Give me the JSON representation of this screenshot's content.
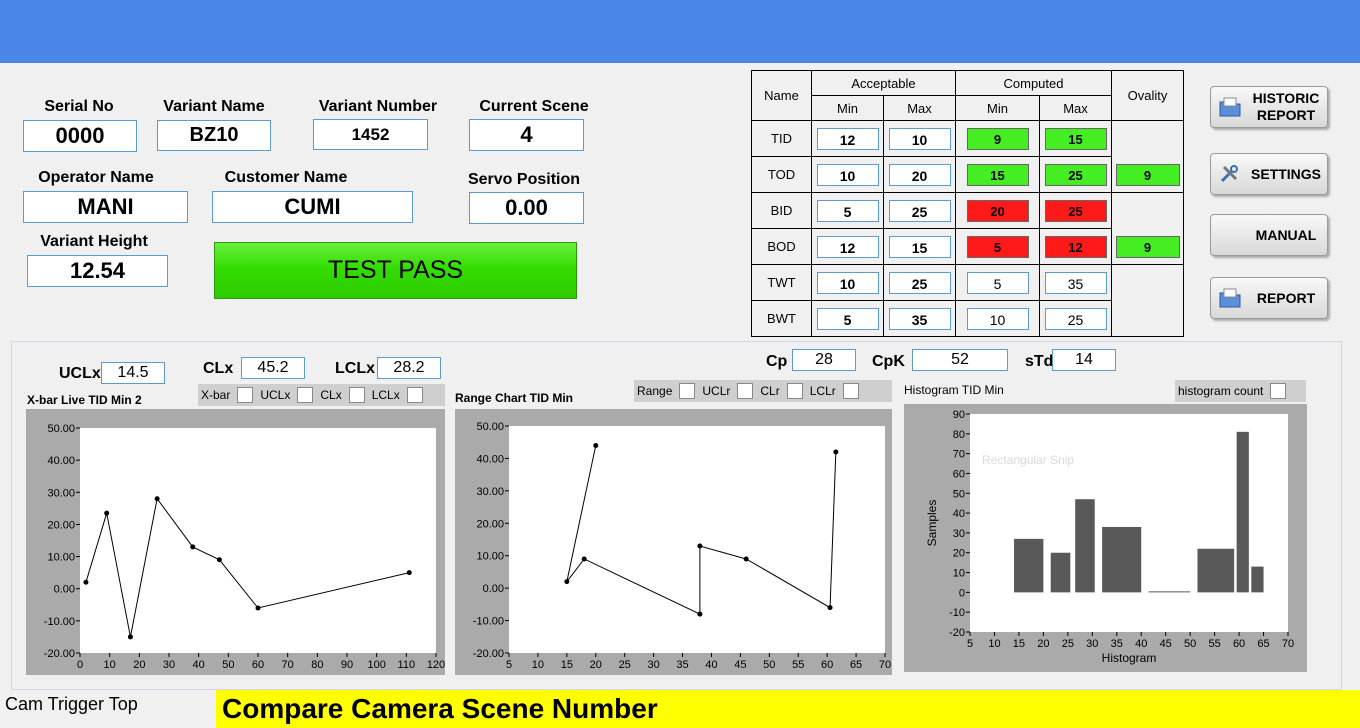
{
  "header": {
    "color": "#4a86e8"
  },
  "fields": {
    "serial_no": {
      "label": "Serial No",
      "value": "0000"
    },
    "variant_name": {
      "label": "Variant Name",
      "value": "BZ10"
    },
    "variant_number": {
      "label": "Variant Number",
      "value": "1452"
    },
    "current_scene": {
      "label": "Current Scene",
      "value": "4"
    },
    "operator_name": {
      "label": "Operator Name",
      "value": "MANI"
    },
    "customer_name": {
      "label": "Customer Name",
      "value": "CUMI"
    },
    "servo_position": {
      "label": "Servo Position",
      "value": "0.00"
    },
    "variant_height": {
      "label": "Variant Height",
      "value": "12.54"
    }
  },
  "test_status": {
    "text": "TEST PASS",
    "color": "#33dd00"
  },
  "spec_table": {
    "name_header": "Name",
    "acceptable_header": "Acceptable",
    "computed_header": "Computed",
    "min_header": "Min",
    "max_header": "Max",
    "ovality_header": "Ovality",
    "rows": [
      {
        "name": "TID",
        "acc_min": "12",
        "acc_max": "10",
        "comp_min": "9",
        "comp_max": "15",
        "min_status": "g",
        "max_status": "g"
      },
      {
        "name": "TOD",
        "acc_min": "10",
        "acc_max": "20",
        "comp_min": "15",
        "comp_max": "25",
        "min_status": "g",
        "max_status": "g"
      },
      {
        "name": "BID",
        "acc_min": "5",
        "acc_max": "25",
        "comp_min": "20",
        "comp_max": "25",
        "min_status": "r",
        "max_status": "r"
      },
      {
        "name": "BOD",
        "acc_min": "12",
        "acc_max": "15",
        "comp_min": "5",
        "comp_max": "12",
        "min_status": "r",
        "max_status": "r"
      },
      {
        "name": "TWT",
        "acc_min": "10",
        "acc_max": "25",
        "comp_min": "5",
        "comp_max": "35",
        "min_status": "b",
        "max_status": "b"
      },
      {
        "name": "BWT",
        "acc_min": "5",
        "acc_max": "35",
        "comp_min": "10",
        "comp_max": "25",
        "min_status": "b",
        "max_status": "b"
      }
    ],
    "ovality_top": "9",
    "ovality_bottom": "9",
    "pass_color": "#44ee22",
    "fail_color": "#ff1a1a"
  },
  "buttons": {
    "historic_report": "HISTORIC REPORT",
    "settings": "SETTINGS",
    "manual": "MANUAL",
    "report": "REPORT"
  },
  "control_limits": {
    "uclx_label": "UCLx",
    "uclx": "14.5",
    "clx_label": "CLx",
    "clx": "45.2",
    "lclx_label": "LCLx",
    "lclx": "28.2",
    "cp_label": "Cp",
    "cp": "28",
    "cpk_label": "CpK",
    "cpk": "52",
    "std_label": "sTd",
    "std": "14"
  },
  "legends": {
    "xbar": [
      "X-bar",
      "UCLx",
      "CLx",
      "LCLx"
    ],
    "range": [
      "Range",
      "UCLr",
      "CLr",
      "LCLr"
    ],
    "histogram": "histogram count"
  },
  "chart_data": [
    {
      "type": "line",
      "title": "X-bar Live TID Min 2",
      "x": [
        2,
        9,
        17,
        26,
        38,
        47,
        60,
        111
      ],
      "y": [
        2,
        23.5,
        -15,
        28,
        13,
        9,
        -6,
        5
      ],
      "xlim": [
        0,
        120
      ],
      "ylim": [
        -20,
        50
      ],
      "xticks": [
        "0",
        "10",
        "20",
        "30",
        "40",
        "50",
        "60",
        "70",
        "80",
        "90",
        "100",
        "110",
        "120"
      ],
      "yticks": [
        "50.00",
        "40.00",
        "30.00",
        "20.00",
        "10.00",
        "0.00",
        "-10.00",
        "-20.00"
      ],
      "grid": false
    },
    {
      "type": "line",
      "title": "Range Chart TID Min",
      "x": [
        15,
        18,
        20,
        38,
        38,
        46,
        60.5,
        61.5
      ],
      "y": [
        2,
        9,
        44,
        -8,
        13,
        9,
        -6,
        42
      ],
      "segments": [
        [
          0,
          2
        ],
        [
          0,
          1,
          3,
          4,
          5,
          6,
          7
        ]
      ],
      "xlim": [
        5,
        70
      ],
      "ylim": [
        -20,
        50
      ],
      "xticks": [
        "5",
        "10",
        "15",
        "20",
        "25",
        "30",
        "35",
        "40",
        "45",
        "50",
        "55",
        "60",
        "65",
        "70"
      ],
      "yticks": [
        "50.00",
        "40.00",
        "30.00",
        "20.00",
        "10.00",
        "0.00",
        "-10.00",
        "-20.00"
      ],
      "grid": false
    },
    {
      "type": "bar",
      "title": "Histogram TID Min",
      "xlabel": "Histogram",
      "ylabel": "Samples",
      "bars": [
        {
          "x0": 14,
          "x1": 20,
          "value": 27
        },
        {
          "x0": 21.5,
          "x1": 25.5,
          "value": 20
        },
        {
          "x0": 26.5,
          "x1": 30.5,
          "value": 47
        },
        {
          "x0": 32,
          "x1": 40,
          "value": 33
        },
        {
          "x0": 41.5,
          "x1": 50,
          "value": 0.5
        },
        {
          "x0": 51.5,
          "x1": 59,
          "value": 22
        },
        {
          "x0": 59.5,
          "x1": 62,
          "value": 81
        },
        {
          "x0": 62.5,
          "x1": 65,
          "value": 13
        }
      ],
      "xlim": [
        5,
        70
      ],
      "ylim": [
        -20,
        90
      ],
      "xticks": [
        "5",
        "10",
        "15",
        "20",
        "25",
        "30",
        "35",
        "40",
        "45",
        "50",
        "55",
        "60",
        "65",
        "70"
      ],
      "yticks": [
        "90",
        "80",
        "70",
        "60",
        "50",
        "40",
        "30",
        "20",
        "10",
        "0",
        "-10",
        "-20"
      ],
      "bar_color": "#595959",
      "watermark": "Rectangular Snip",
      "grid": false
    }
  ],
  "bottom": {
    "cam_trigger": "Cam Trigger Top",
    "message": "Compare Camera Scene Number",
    "message_bg": "#ffff00"
  }
}
